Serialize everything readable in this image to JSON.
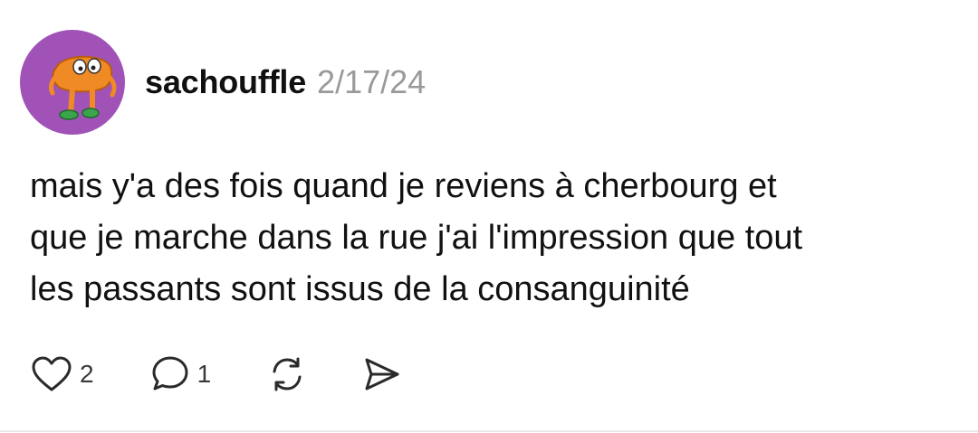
{
  "post": {
    "username": "sachouffle",
    "date": "2/17/24",
    "text": "mais y'a des fois quand je reviens à cherbourg et\nque je marche dans la rue j'ai l'impression que tout\nles passants sont issus de la consanguinité",
    "like_count": "2",
    "reply_count": "1"
  },
  "icons": {
    "avatar": "cartoon-character-avatar",
    "like": "heart-icon",
    "reply": "speech-bubble-icon",
    "repost": "repost-arrows-icon",
    "share": "send-icon"
  },
  "colors": {
    "avatar_background": "#a052b7",
    "avatar_character": "#f08a24",
    "secondary_text": "#9a9a9a"
  }
}
